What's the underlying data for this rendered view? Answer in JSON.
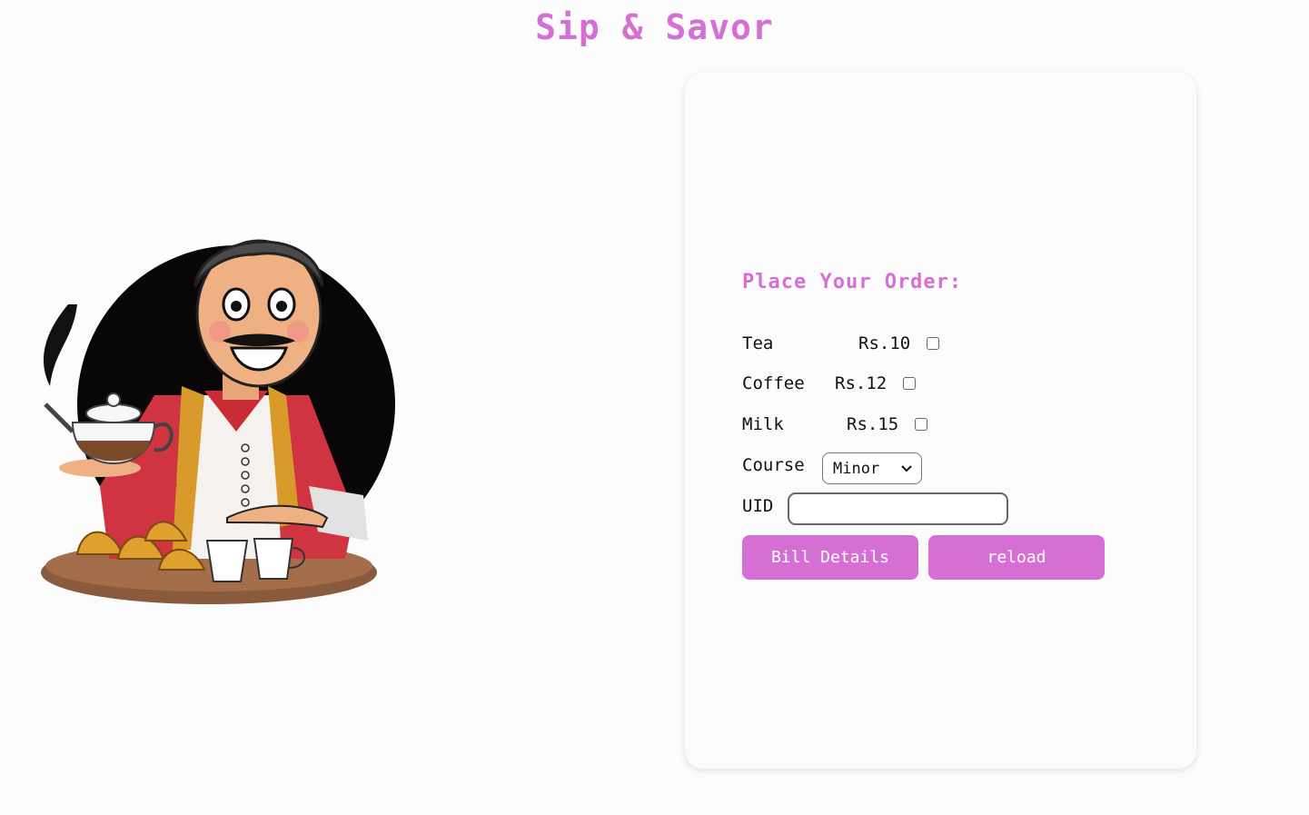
{
  "header": {
    "title": "Sip & Savor"
  },
  "order": {
    "heading": "Place Your Order:",
    "items": [
      {
        "name": "Tea",
        "price": "Rs.10"
      },
      {
        "name": "Coffee",
        "price": "Rs.12"
      },
      {
        "name": "Milk",
        "price": "Rs.15"
      }
    ],
    "course_label": "Course",
    "course_value": "Minor",
    "uid_label": "UID",
    "uid_value": "",
    "bill_button": "Bill Details",
    "reload_button": "reload"
  },
  "colors": {
    "accent": "#d56fd3",
    "card_bg": "#fcfbfc"
  },
  "icons": {
    "hero": "chai-vendor-illustration",
    "dropdown": "chevron-down-icon"
  }
}
